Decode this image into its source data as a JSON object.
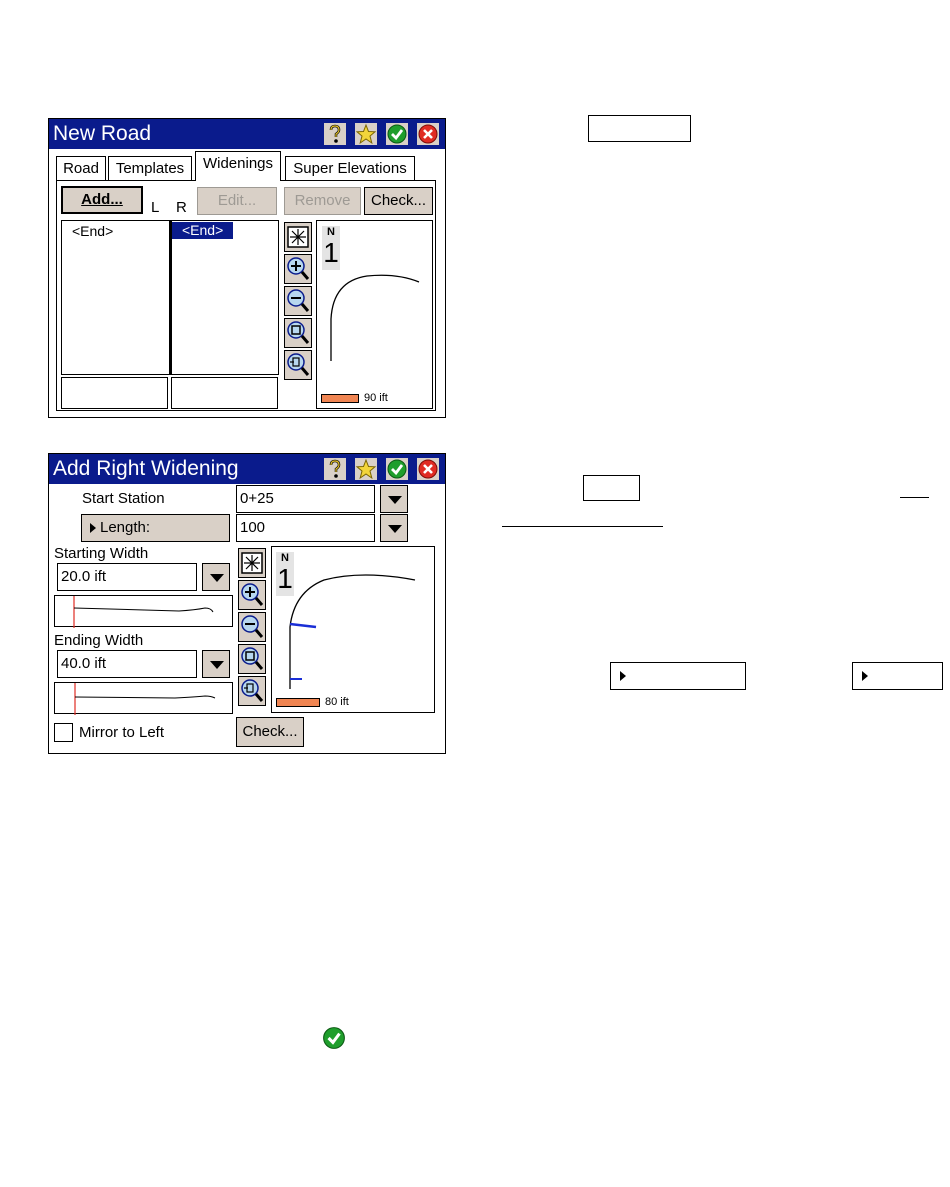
{
  "window_new_road": {
    "title": "New Road",
    "tabs": [
      "Road",
      "Templates",
      "Widenings",
      "Super Elevations"
    ],
    "active_tab": "Widenings",
    "add_label": "Add...",
    "left_label": "L",
    "right_label": "R",
    "edit_label": "Edit...",
    "remove_label": "Remove",
    "check_label": "Check...",
    "left_list": [
      "<End>"
    ],
    "right_list": [
      "<End>"
    ],
    "scale_label": "90 ift",
    "north_label": "N",
    "north_num": "1"
  },
  "window_add_widening": {
    "title": "Add Right Widening",
    "start_station_label": "Start Station",
    "start_station_value": "0+25",
    "length_label": "Length:",
    "length_value": "100",
    "starting_width_label": "Starting Width",
    "starting_width_value": "20.0 ift",
    "ending_width_label": "Ending Width",
    "ending_width_value": "40.0 ift",
    "mirror_label": "Mirror to Left",
    "check_label": "Check...",
    "scale_label": "80 ift",
    "north_label": "N",
    "north_num": "1"
  },
  "icons": [
    "help-icon",
    "favorite-star-icon",
    "ok-check-icon",
    "close-icon"
  ],
  "colors": {
    "titlebar": "#0a1b8c",
    "button_face": "#d9d0c7",
    "scale_bar": "#f08552",
    "ok_green": "#1f9e2c",
    "close_red": "#e02b23",
    "widening_blue": "#1a2ed6"
  }
}
